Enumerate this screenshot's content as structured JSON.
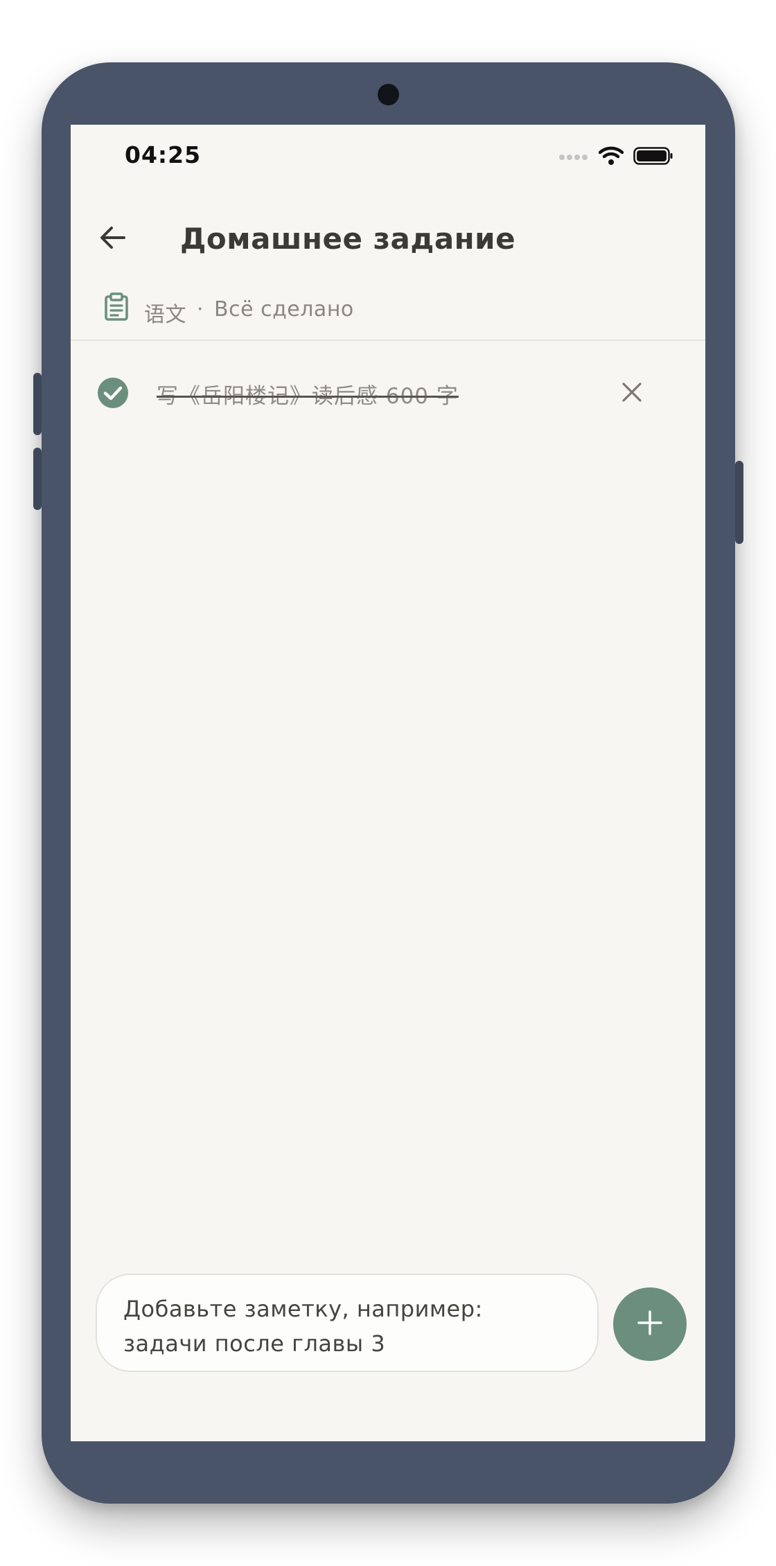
{
  "status_bar": {
    "time": "04:25"
  },
  "header": {
    "title": "Домашнее задание",
    "back_icon": "arrow-left-icon"
  },
  "subheader": {
    "icon": "clipboard-icon",
    "subject": "语文",
    "separator": "·",
    "status": "Всё сделано"
  },
  "tasks": [
    {
      "text": "写《岳阳楼记》读后感 600 字",
      "completed": true,
      "check_icon": "check-circle-icon",
      "delete_icon": "close-icon"
    }
  ],
  "composer": {
    "placeholder": "Добавьте заметку, например:\nзадачи после главы 3",
    "add_icon": "plus-icon"
  },
  "colors": {
    "accent": "#6b8f7c",
    "background": "#f7f6f2",
    "frame": "#4a5468",
    "title_text": "#3b3a36",
    "muted_text": "#8a8782"
  }
}
